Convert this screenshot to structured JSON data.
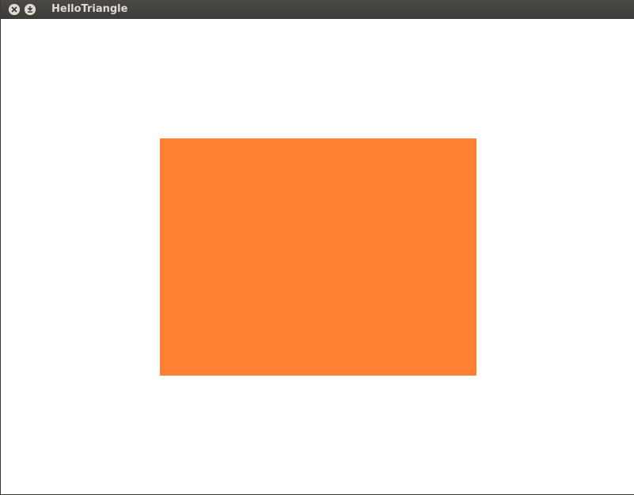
{
  "window": {
    "title": "HelloTriangle",
    "buttons": [
      {
        "name": "close-button",
        "icon": "close-icon"
      },
      {
        "name": "minimize-button",
        "icon": "minimize-icon"
      }
    ]
  },
  "canvas": {
    "background_color": "#ffffff",
    "shape_color": "#ff8033"
  }
}
